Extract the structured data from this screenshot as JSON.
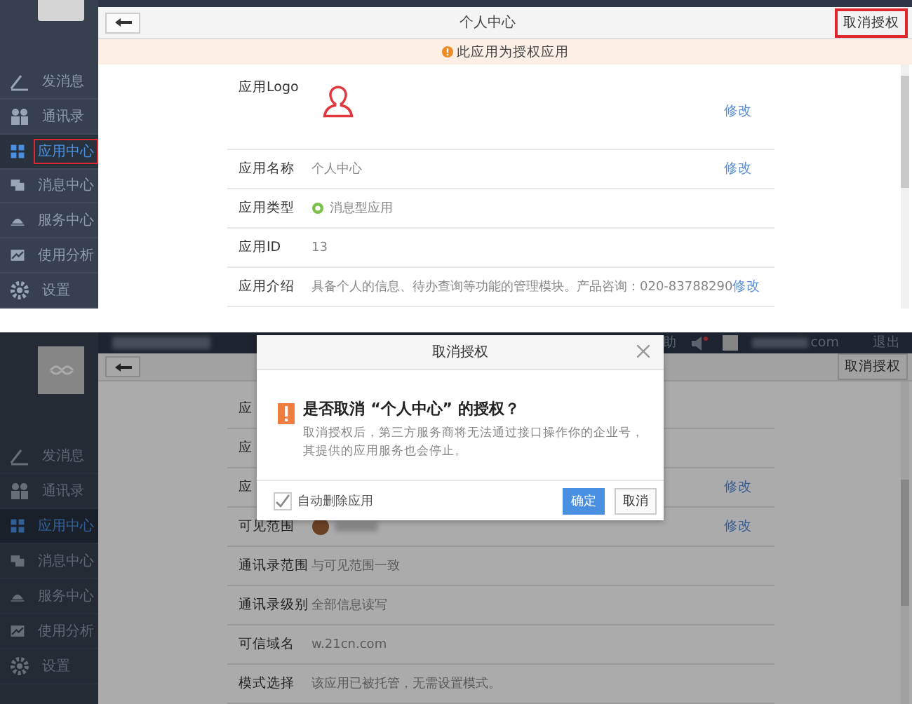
{
  "panels": [
    {
      "kind": "detail",
      "sidebar": {
        "items": [
          {
            "label": "发消息",
            "selected": false,
            "annotated": false
          },
          {
            "label": "通讯录",
            "selected": false,
            "annotated": false
          },
          {
            "label": "应用中心",
            "selected": true,
            "annotated": true
          },
          {
            "label": "消息中心",
            "selected": false,
            "annotated": false
          },
          {
            "label": "服务中心",
            "selected": false,
            "annotated": false
          },
          {
            "label": "使用分析",
            "selected": false,
            "annotated": false
          },
          {
            "label": "设置",
            "selected": false,
            "annotated": false
          }
        ]
      },
      "header": {
        "title": "个人中心",
        "action": {
          "label": "取消授权",
          "annotated": true
        }
      },
      "notice": "此应用为授权应用",
      "fields": [
        {
          "kind": "logo",
          "label": "应用Logo",
          "edit": "修改"
        },
        {
          "kind": "text",
          "label": "应用名称",
          "value": "个人中心",
          "edit": "修改"
        },
        {
          "kind": "status",
          "label": "应用类型",
          "value": "消息型应用"
        },
        {
          "kind": "text",
          "label": "应用ID",
          "value": "13"
        },
        {
          "kind": "text",
          "label": "应用介绍",
          "value": "具备个人的信息、待办查询等功能的管理模块。产品咨询：020-83788290",
          "edit": "修改"
        }
      ]
    },
    {
      "kind": "dialog",
      "topbar": {
        "help": "助",
        "account": "com",
        "logout": "退出"
      },
      "sidebar": {
        "items": [
          {
            "label": "发消息",
            "selected": false,
            "annotated": false
          },
          {
            "label": "通讯录",
            "selected": false,
            "annotated": false
          },
          {
            "label": "应用中心",
            "selected": true,
            "annotated": false
          },
          {
            "label": "消息中心",
            "selected": false,
            "annotated": false
          },
          {
            "label": "服务中心",
            "selected": false,
            "annotated": false
          },
          {
            "label": "使用分析",
            "selected": false,
            "annotated": false
          },
          {
            "label": "设置",
            "selected": false,
            "annotated": false
          }
        ]
      },
      "header": {
        "action": {
          "label": "取消授权",
          "annotated": false
        }
      },
      "fields": [
        {
          "kind": "text",
          "label": "应"
        },
        {
          "kind": "text",
          "label": "应"
        },
        {
          "kind": "text",
          "label": "应",
          "edit": "修改"
        },
        {
          "kind": "member",
          "label": "可见范围",
          "edit": "修改"
        },
        {
          "kind": "text",
          "label": "通讯录范围",
          "value": "与可见范围一致"
        },
        {
          "kind": "text",
          "label": "通讯录级别",
          "value": "全部信息读写"
        },
        {
          "kind": "text",
          "label": "可信域名",
          "value": "w.21cn.com"
        },
        {
          "kind": "text",
          "label": "模式选择",
          "value": "该应用已被托管，无需设置模式。"
        }
      ],
      "dialog": {
        "title": "取消授权",
        "heading": "是否取消 “个人中心” 的授权？",
        "message": "取消授权后，第三方服务商将无法通过接口操作你的企业号，其提供的应用服务也会停止。",
        "option": {
          "label": "自动删除应用",
          "checked": true
        },
        "buttons": [
          {
            "label": "确定",
            "kind": "primary"
          },
          {
            "label": "取消",
            "kind": "default"
          }
        ]
      }
    }
  ]
}
